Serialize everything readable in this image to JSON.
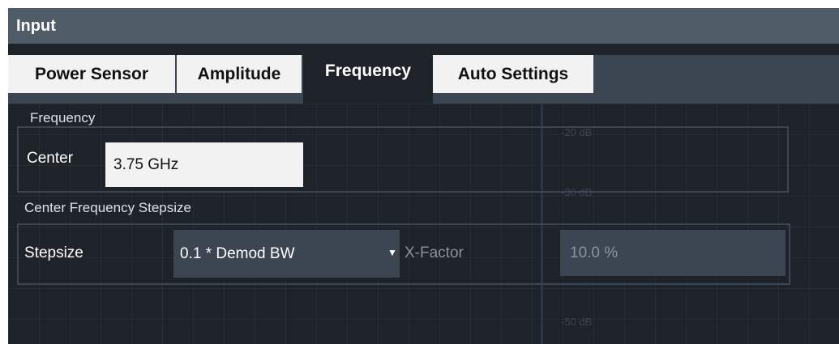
{
  "dialog": {
    "title": "Input"
  },
  "tabs": [
    {
      "label": "Power Sensor"
    },
    {
      "label": "Amplitude"
    },
    {
      "label": "Frequency"
    },
    {
      "label": "Auto Settings"
    }
  ],
  "active_tab": "Frequency",
  "background_grid_labels": [
    "-20 dB",
    "-30 dB",
    "-50 dB"
  ],
  "frequency_section": {
    "title": "Frequency",
    "center_label": "Center",
    "center_value": "3.75 GHz"
  },
  "stepsize_section": {
    "title": "Center Frequency Stepsize",
    "stepsize_label": "Stepsize",
    "stepsize_value": "0.1 * Demod BW",
    "xfactor_label": "X-Factor",
    "xfactor_value": "10.0 %"
  },
  "colors": {
    "titlebar": "#505b68",
    "background": "#1e2229",
    "panel": "#3c4653",
    "input_bg": "#f2f2f2"
  }
}
